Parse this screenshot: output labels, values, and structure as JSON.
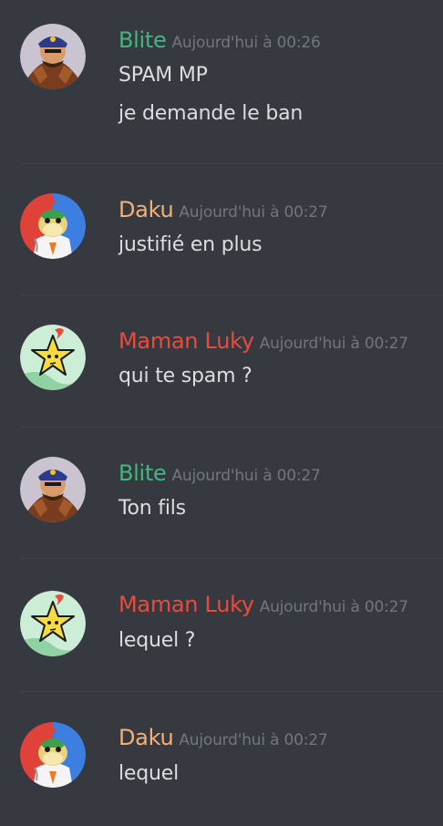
{
  "messages": [
    {
      "author": "Blite",
      "author_color": "#43b581",
      "avatar_icon": "wario-style-character-avatar",
      "timestamp": "Aujourd'hui à 00:26",
      "lines": [
        "SPAM MP",
        "je demande le ban"
      ]
    },
    {
      "author": "Daku",
      "author_color": "#f0b27a",
      "avatar_icon": "bowser-jr-doctor-avatar",
      "timestamp": "Aujourd'hui à 00:27",
      "lines": [
        "justifié en plus"
      ]
    },
    {
      "author": "Maman Luky",
      "author_color": "#e74c3c",
      "avatar_icon": "star-face-avatar",
      "timestamp": "Aujourd'hui à 00:27",
      "lines": [
        "qui te spam ?"
      ]
    },
    {
      "author": "Blite",
      "author_color": "#43b581",
      "avatar_icon": "wario-style-character-avatar",
      "timestamp": "Aujourd'hui à 00:27",
      "lines": [
        "Ton fils"
      ]
    },
    {
      "author": "Maman Luky",
      "author_color": "#e74c3c",
      "avatar_icon": "star-face-avatar",
      "timestamp": "Aujourd'hui à 00:27",
      "lines": [
        "lequel ?"
      ]
    },
    {
      "author": "Daku",
      "author_color": "#f0b27a",
      "avatar_icon": "bowser-jr-doctor-avatar",
      "timestamp": "Aujourd'hui à 00:27",
      "lines": [
        "lequel"
      ]
    }
  ]
}
